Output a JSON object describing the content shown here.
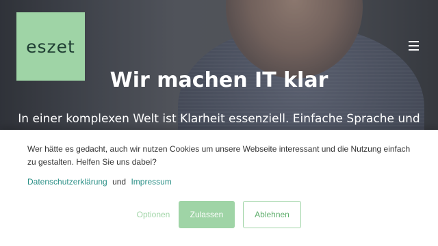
{
  "header": {
    "logo_text": "eszet",
    "menu_icon": "hamburger-menu-icon"
  },
  "hero": {
    "title": "Wir machen IT klar",
    "subtitle": "In einer komplexen Welt ist Klarheit essenziell. Einfache Sprache und"
  },
  "cookie_banner": {
    "message": "Wer hätte es gedacht, auch wir nutzen Cookies um unsere Webseite interessant und die Nutzung einfach zu gestalten. Helfen Sie uns dabei?",
    "privacy_link": "Datenschutzerklärung",
    "conjunction": "und",
    "imprint_link": "Impressum",
    "options_label": "Optionen",
    "allow_label": "Zulassen",
    "deny_label": "Ablehnen"
  },
  "colors": {
    "brand_green": "#9fd4a6",
    "link_teal": "#2a8f86",
    "logo_text": "#1f3e33"
  }
}
